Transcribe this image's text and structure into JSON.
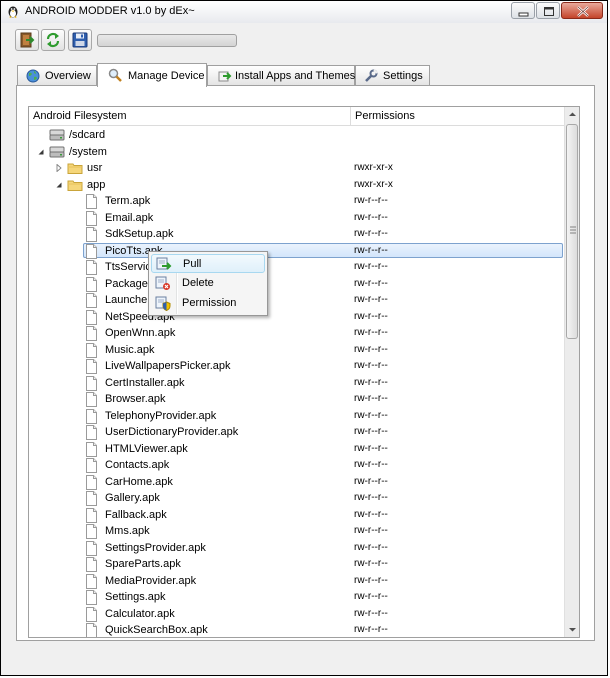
{
  "window": {
    "title": "ANDROID MODDER v1.0 by dEx~",
    "controls": [
      "minimize",
      "maximize",
      "close"
    ]
  },
  "toolbar": {
    "buttons": [
      {
        "name": "exit",
        "icon": "exit-door-icon"
      },
      {
        "name": "refresh",
        "icon": "refresh-icon"
      },
      {
        "name": "save",
        "icon": "floppy-disk-icon"
      }
    ],
    "progress": 0
  },
  "tabs": [
    {
      "label": "Overview",
      "icon": "globe-icon",
      "active": false
    },
    {
      "label": "Manage Device",
      "icon": "magnifier-icon",
      "active": true
    },
    {
      "label": "Install Apps and Themes",
      "icon": "install-arrow-icon",
      "active": false
    },
    {
      "label": "Settings",
      "icon": "wrench-icon",
      "active": false
    }
  ],
  "tree": {
    "columns": [
      "Android Filesystem",
      "Permissions"
    ],
    "rows": [
      {
        "name": "/sdcard",
        "perm": "",
        "level": 0,
        "type": "drive",
        "arrow": "none"
      },
      {
        "name": "/system",
        "perm": "",
        "level": 0,
        "type": "drive",
        "arrow": "expanded"
      },
      {
        "name": "usr",
        "perm": "rwxr-xr-x",
        "level": 1,
        "type": "folder",
        "arrow": "collapsed"
      },
      {
        "name": "app",
        "perm": "rwxr-xr-x",
        "level": 1,
        "type": "folder",
        "arrow": "expanded"
      },
      {
        "name": "Term.apk",
        "perm": "rw-r--r--",
        "level": 2,
        "type": "file",
        "arrow": "none"
      },
      {
        "name": "Email.apk",
        "perm": "rw-r--r--",
        "level": 2,
        "type": "file",
        "arrow": "none"
      },
      {
        "name": "SdkSetup.apk",
        "perm": "rw-r--r--",
        "level": 2,
        "type": "file",
        "arrow": "none"
      },
      {
        "name": "PicoTts.apk",
        "perm": "rw-r--r--",
        "level": 2,
        "type": "file",
        "arrow": "none",
        "selected": true
      },
      {
        "name": "TtsServic",
        "perm": "rw-r--r--",
        "level": 2,
        "type": "file",
        "arrow": "none"
      },
      {
        "name": "PackageI",
        "perm": "rw-r--r--",
        "level": 2,
        "type": "file",
        "arrow": "none"
      },
      {
        "name": "Launche",
        "perm": "rw-r--r--",
        "level": 2,
        "type": "file",
        "arrow": "none"
      },
      {
        "name": "NetSpeed.apk",
        "perm": "rw-r--r--",
        "level": 2,
        "type": "file",
        "arrow": "none"
      },
      {
        "name": "OpenWnn.apk",
        "perm": "rw-r--r--",
        "level": 2,
        "type": "file",
        "arrow": "none"
      },
      {
        "name": "Music.apk",
        "perm": "rw-r--r--",
        "level": 2,
        "type": "file",
        "arrow": "none"
      },
      {
        "name": "LiveWallpapersPicker.apk",
        "perm": "rw-r--r--",
        "level": 2,
        "type": "file",
        "arrow": "none"
      },
      {
        "name": "CertInstaller.apk",
        "perm": "rw-r--r--",
        "level": 2,
        "type": "file",
        "arrow": "none"
      },
      {
        "name": "Browser.apk",
        "perm": "rw-r--r--",
        "level": 2,
        "type": "file",
        "arrow": "none"
      },
      {
        "name": "TelephonyProvider.apk",
        "perm": "rw-r--r--",
        "level": 2,
        "type": "file",
        "arrow": "none"
      },
      {
        "name": "UserDictionaryProvider.apk",
        "perm": "rw-r--r--",
        "level": 2,
        "type": "file",
        "arrow": "none"
      },
      {
        "name": "HTMLViewer.apk",
        "perm": "rw-r--r--",
        "level": 2,
        "type": "file",
        "arrow": "none"
      },
      {
        "name": "Contacts.apk",
        "perm": "rw-r--r--",
        "level": 2,
        "type": "file",
        "arrow": "none"
      },
      {
        "name": "CarHome.apk",
        "perm": "rw-r--r--",
        "level": 2,
        "type": "file",
        "arrow": "none"
      },
      {
        "name": "Gallery.apk",
        "perm": "rw-r--r--",
        "level": 2,
        "type": "file",
        "arrow": "none"
      },
      {
        "name": "Fallback.apk",
        "perm": "rw-r--r--",
        "level": 2,
        "type": "file",
        "arrow": "none"
      },
      {
        "name": "Mms.apk",
        "perm": "rw-r--r--",
        "level": 2,
        "type": "file",
        "arrow": "none"
      },
      {
        "name": "SettingsProvider.apk",
        "perm": "rw-r--r--",
        "level": 2,
        "type": "file",
        "arrow": "none"
      },
      {
        "name": "SpareParts.apk",
        "perm": "rw-r--r--",
        "level": 2,
        "type": "file",
        "arrow": "none"
      },
      {
        "name": "MediaProvider.apk",
        "perm": "rw-r--r--",
        "level": 2,
        "type": "file",
        "arrow": "none"
      },
      {
        "name": "Settings.apk",
        "perm": "rw-r--r--",
        "level": 2,
        "type": "file",
        "arrow": "none"
      },
      {
        "name": "Calculator.apk",
        "perm": "rw-r--r--",
        "level": 2,
        "type": "file",
        "arrow": "none"
      },
      {
        "name": "QuickSearchBox.apk",
        "perm": "rw-r--r--",
        "level": 2,
        "type": "file",
        "arrow": "none"
      }
    ]
  },
  "context_menu": {
    "items": [
      {
        "label": "Pull",
        "icon": "pull-arrow-icon",
        "highlighted": true
      },
      {
        "label": "Delete",
        "icon": "delete-icon",
        "highlighted": false
      },
      {
        "label": "Permission",
        "icon": "permission-shield-icon",
        "highlighted": false
      }
    ]
  },
  "colors": {
    "selection": "#d3e6fb",
    "folder": "#f5d67a",
    "window_bg": "#f0f0f0"
  }
}
